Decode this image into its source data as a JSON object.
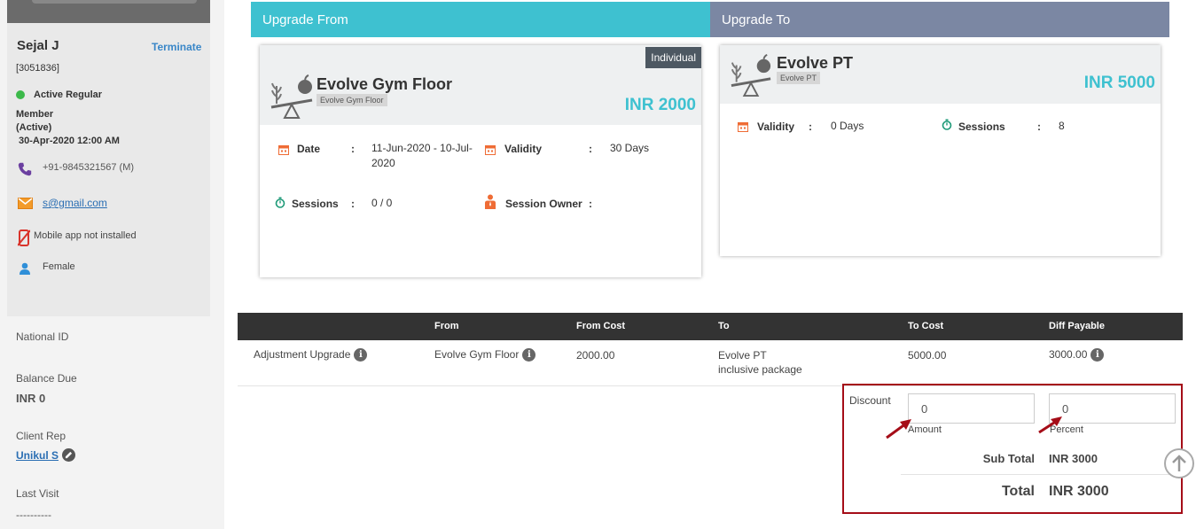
{
  "member": {
    "name": "Sejal J",
    "terminate_label": "Terminate",
    "id": "[3051836]",
    "status": "Active Regular",
    "member_line1": "Member",
    "member_line2": "(Active)",
    "since": "30-Apr-2020 12:00 AM",
    "phone": "+91-9845321567 (M)",
    "email": "s@gmail.com",
    "app_status": "Mobile app not installed",
    "gender": "Female"
  },
  "side_info": {
    "national_id_label": "National ID",
    "balance_label": "Balance Due",
    "balance_value": "INR 0",
    "client_rep_label": "Client Rep",
    "client_rep_value": "Unikul S",
    "last_visit_label": "Last Visit",
    "last_visit_value": "----------"
  },
  "upgrade_from": {
    "header": "Upgrade From",
    "badge": "Individual",
    "title": "Evolve Gym Floor",
    "tag": "Evolve Gym Floor",
    "price": "INR 2000",
    "date_label": "Date",
    "date_line1": "11-Jun-2020 - 10-Jul-",
    "date_line2": "2020",
    "validity_label": "Validity",
    "validity_value": "30 Days",
    "sessions_label": "Sessions",
    "sessions_value": "0 / 0",
    "owner_label": "Session Owner",
    "colon": ":"
  },
  "upgrade_to": {
    "header": "Upgrade To",
    "title": "Evolve PT",
    "tag": "Evolve PT",
    "price": "INR 5000",
    "validity_label": "Validity",
    "validity_value": "0 Days",
    "sessions_label": "Sessions",
    "sessions_value": "8",
    "colon": ":"
  },
  "table": {
    "headers": [
      "From",
      "From Cost",
      "To",
      "To Cost",
      "Diff Payable"
    ],
    "row": {
      "type": "Adjustment Upgrade",
      "from": "Evolve Gym Floor",
      "from_cost": "2000.00",
      "to_line1": "Evolve PT",
      "to_line2": "inclusive package",
      "to_cost": "5000.00",
      "diff": "3000.00"
    }
  },
  "discount": {
    "label": "Discount",
    "amount_value": "0",
    "amount_label": "Amount",
    "percent_value": "0",
    "percent_label": "Percent",
    "subtotal_label": "Sub Total",
    "subtotal_value": "INR 3000",
    "total_label": "Total",
    "total_value": "INR 3000"
  },
  "colors": {
    "accent_teal": "#3ec1d0",
    "upgrade_to_header": "#7b87a3",
    "highlight_border": "#a50d18",
    "active_green": "#3cb94a",
    "icon_orange": "#ef6c35",
    "icon_purple": "#6b3fa0",
    "icon_blue": "#2f8fd8"
  }
}
